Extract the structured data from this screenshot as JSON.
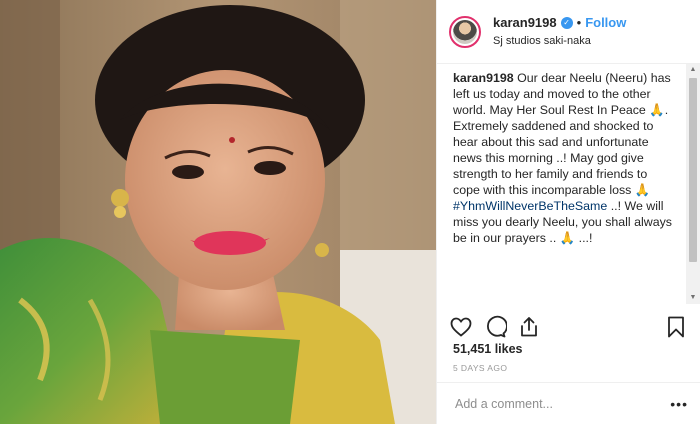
{
  "post": {
    "username": "karan9198",
    "verified_icon": "verified-badge-icon",
    "separator": "•",
    "follow_label": "Follow",
    "location": "Sj studios saki-naka",
    "caption": {
      "username": "karan9198",
      "part1": "Our dear Neelu (Neeru) has left us today and moved to the other world. May Her Soul Rest In Peace",
      "emoji1": "🙏",
      "part2": ". Extremely saddened and shocked to hear about this sad and unfortunate news this morning ..! May god give strength to her family and friends to cope with this incomparable loss",
      "emoji2": "🙏",
      "hashtag": "#YhmWillNeverBeTheSame",
      "part3": "..! We will miss you dearly Neelu, you shall always be in our prayers ..",
      "emoji3": "🙏",
      "part4": "...!"
    },
    "likes": "51,451 likes",
    "time": "5 DAYS AGO",
    "comment_placeholder": "Add a comment...",
    "more_label": "•••",
    "colors": {
      "link": "#3897f0",
      "hashtag": "#003569",
      "text": "#262626",
      "muted": "#999999"
    }
  },
  "icons": [
    "heart-icon",
    "comment-icon",
    "share-icon",
    "bookmark-icon",
    "scroll-up-arrow-icon",
    "scroll-down-arrow-icon",
    "more-options-icon"
  ]
}
